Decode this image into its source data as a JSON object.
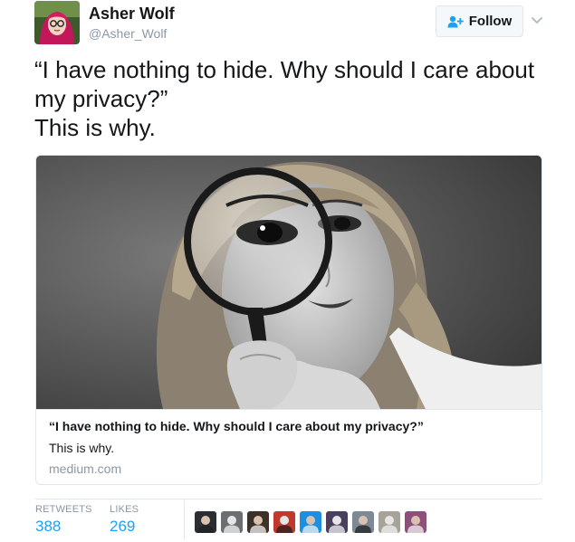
{
  "author": {
    "name": "Asher Wolf",
    "handle": "@Asher_Wolf"
  },
  "follow_button": {
    "label": "Follow"
  },
  "tweet": {
    "lines": [
      "“I have nothing to hide. Why should I care about my privacy?”",
      "This is why."
    ]
  },
  "card": {
    "title": "“I have nothing to hide. Why should I care about my privacy?”",
    "description": "This is why.",
    "domain": "medium.com"
  },
  "stats": {
    "retweets_label": "RETWEETS",
    "retweets_count": "388",
    "likes_label": "LIKES",
    "likes_count": "269"
  },
  "likers": [
    {
      "icon": "liker-avatar-1",
      "color": "#2b2f33"
    },
    {
      "icon": "liker-avatar-2",
      "color": "#6b6f73"
    },
    {
      "icon": "liker-avatar-3",
      "color": "#3d3228"
    },
    {
      "icon": "liker-avatar-4",
      "color": "#c0392b"
    },
    {
      "icon": "liker-avatar-5",
      "color": "#1d8fe0"
    },
    {
      "icon": "liker-avatar-6",
      "color": "#4a3f5c"
    },
    {
      "icon": "liker-avatar-7",
      "color": "#7d8a96"
    },
    {
      "icon": "liker-avatar-8",
      "color": "#a7a29a"
    },
    {
      "icon": "liker-avatar-9",
      "color": "#8e4f7a"
    }
  ],
  "colors": {
    "link": "#1da1f2",
    "muted": "#8b98a5",
    "text": "#14171a",
    "border": "#e1e8ed"
  }
}
